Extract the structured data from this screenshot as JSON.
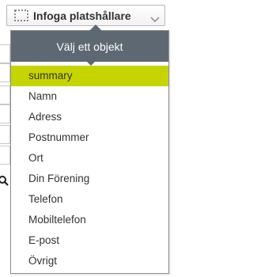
{
  "trigger": {
    "label": "Infoga platshållare"
  },
  "panel": {
    "title": "Välj ett objekt",
    "items": [
      {
        "label": "summary",
        "selected": true
      },
      {
        "label": "Namn"
      },
      {
        "label": "Adress"
      },
      {
        "label": "Postnummer"
      },
      {
        "label": "Ort"
      },
      {
        "label": "Din Förening"
      },
      {
        "label": "Telefon"
      },
      {
        "label": "Mobiltelefon"
      },
      {
        "label": "E-post"
      },
      {
        "label": "Övrigt"
      }
    ]
  },
  "colors": {
    "header_bg": "#5d6872",
    "selected_bg": "#c6d400",
    "text": "#333333"
  },
  "icons": {
    "trigger_icon": "placeholder-dashed-box-icon",
    "trigger_chevron": "chevron-down-icon",
    "background_search": "search-icon"
  }
}
